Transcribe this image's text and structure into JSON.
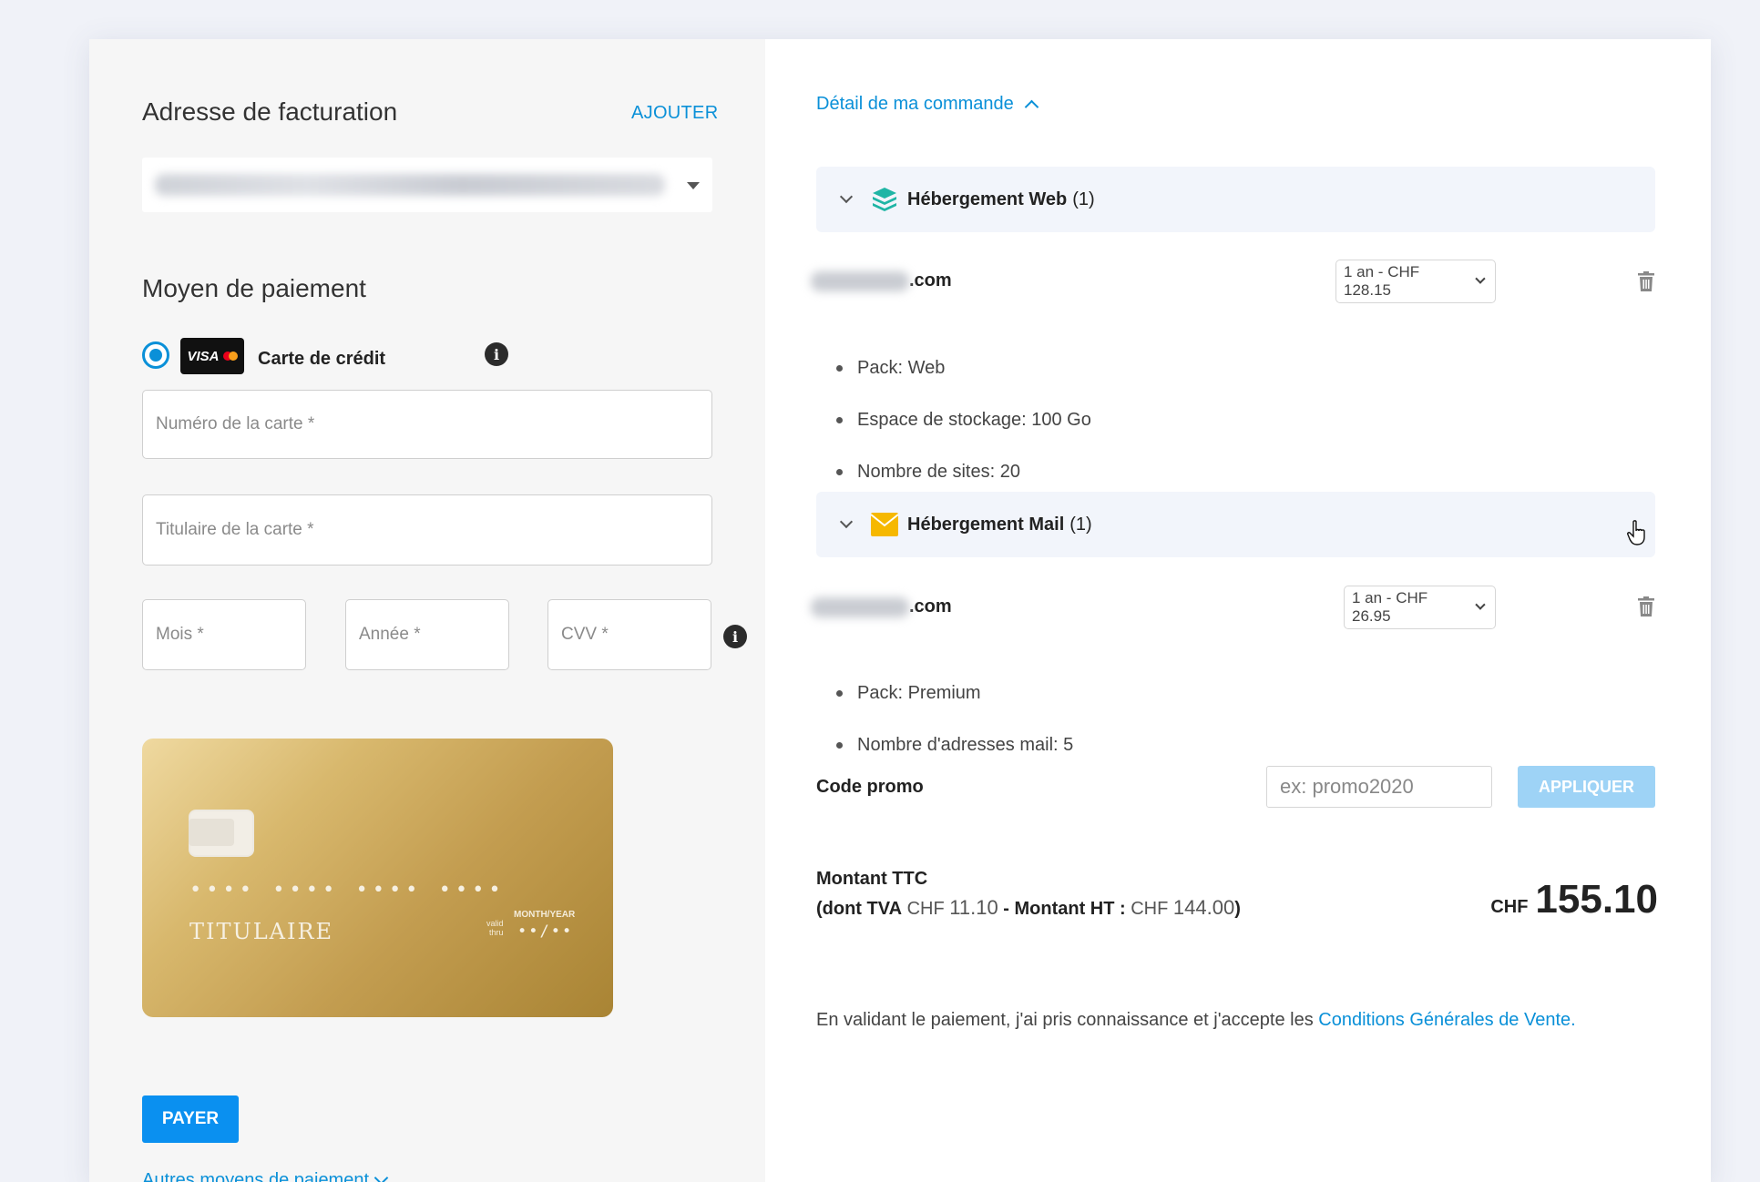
{
  "billing": {
    "title": "Adresse de facturation",
    "add_label": "AJOUTER"
  },
  "payment": {
    "title": "Moyen de paiement",
    "method_label": "Carte de crédit",
    "card_badge": "VISA",
    "fields": {
      "card_number": "Numéro de la carte *",
      "card_holder": "Titulaire de la carte *",
      "month": "Mois *",
      "year": "Année *",
      "cvv": "CVV *"
    },
    "card_preview": {
      "number": "•••• •••• •••• ••••",
      "holder": "TITULAIRE",
      "valid_line1": "valid",
      "valid_line2": "thru",
      "month_year_label": "MONTH/YEAR",
      "expiry": "••/••"
    },
    "pay_label": "PAYER",
    "other_methods_label": "Autres moyens de paiement"
  },
  "order": {
    "detail_label": "Détail de ma commande",
    "sections": [
      {
        "title": "Hébergement Web",
        "count": "(1)",
        "domain_suffix": ".com",
        "period": "1 an - CHF 128.15",
        "features": [
          "Pack: Web",
          "Espace de stockage: 100 Go",
          "Nombre de sites: 20"
        ]
      },
      {
        "title": "Hébergement Mail",
        "count": "(1)",
        "domain_suffix": ".com",
        "period": "1 an - CHF 26.95",
        "features": [
          "Pack: Premium",
          "Nombre d'adresses mail: 5"
        ]
      }
    ],
    "promo": {
      "label": "Code promo",
      "placeholder": "ex: promo2020",
      "apply_label": "APPLIQUER"
    },
    "totals": {
      "label": "Montant TTC",
      "tva_prefix": "(dont TVA",
      "tva_currency": "CHF",
      "tva_value": "11.10",
      "ht_label": "- Montant HT :",
      "ht_currency": "CHF",
      "ht_value": "144.00",
      "ht_suffix": ")",
      "total_currency": "CHF",
      "total_value": "155.10"
    },
    "terms_text": "En validant le paiement, j'ai pris connaissance et j'accepte les",
    "terms_link": "Conditions Générales de Vente."
  },
  "colors": {
    "accent": "#0a90d8",
    "pay_button": "#0a90f0",
    "apply_button": "#9ed3f6",
    "web_icon": "#1fb5a5",
    "mail_icon": "#f6b800"
  }
}
